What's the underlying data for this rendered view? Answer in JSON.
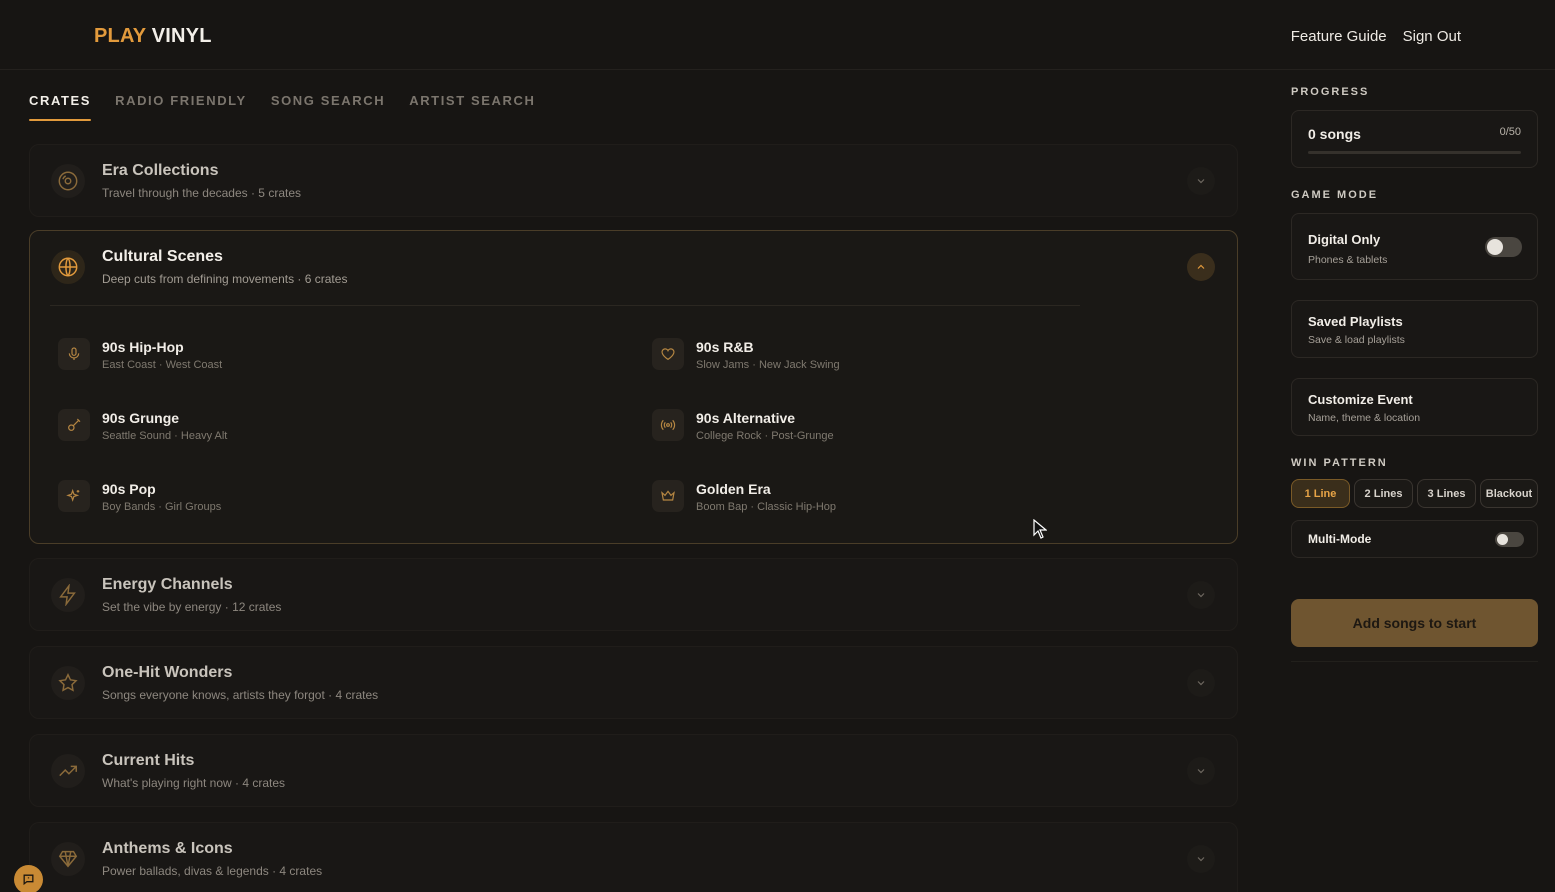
{
  "app": {
    "logo_accent": "PLAY",
    "logo_rest": "VINYL",
    "nav": [
      "Feature Guide",
      "Sign Out"
    ]
  },
  "tabs": [
    {
      "label": "CRATES",
      "active": true
    },
    {
      "label": "RADIO FRIENDLY",
      "active": false
    },
    {
      "label": "SONG SEARCH",
      "active": false
    },
    {
      "label": "ARTIST SEARCH",
      "active": false
    }
  ],
  "categories": [
    {
      "title": "Era Collections",
      "subtitle": "Travel through the decades · 5 crates",
      "icon": "vinyl-icon",
      "open": false
    },
    {
      "title": "Cultural Scenes",
      "subtitle": "Deep cuts from defining movements · 6 crates",
      "icon": "globe-icon",
      "open": true,
      "crates": [
        {
          "title": "90s Hip-Hop",
          "subtitle": "East Coast · West Coast",
          "icon": "microphone-icon"
        },
        {
          "title": "90s R&B",
          "subtitle": "Slow Jams · New Jack Swing",
          "icon": "heart-icon"
        },
        {
          "title": "90s Grunge",
          "subtitle": "Seattle Sound · Heavy Alt",
          "icon": "guitar-icon"
        },
        {
          "title": "90s Alternative",
          "subtitle": "College Rock · Post-Grunge",
          "icon": "radio-waves-icon"
        },
        {
          "title": "90s Pop",
          "subtitle": "Boy Bands · Girl Groups",
          "icon": "sparkles-icon"
        },
        {
          "title": "Golden Era",
          "subtitle": "Boom Bap · Classic Hip-Hop",
          "icon": "crown-icon"
        }
      ]
    },
    {
      "title": "Energy Channels",
      "subtitle": "Set the vibe by energy · 12 crates",
      "icon": "lightning-icon",
      "open": false
    },
    {
      "title": "One-Hit Wonders",
      "subtitle": "Songs everyone knows, artists they forgot · 4 crates",
      "icon": "star-icon",
      "open": false
    },
    {
      "title": "Current Hits",
      "subtitle": "What's playing right now · 4 crates",
      "icon": "trending-up-icon",
      "open": false
    },
    {
      "title": "Anthems & Icons",
      "subtitle": "Power ballads, divas & legends · 4 crates",
      "icon": "diamond-icon",
      "open": false
    }
  ],
  "sidebar": {
    "progress_label": "PROGRESS",
    "progress_songs": "0 songs",
    "progress_count": "0/50",
    "progress_value": 0,
    "game_mode_label": "GAME MODE",
    "digital_title": "Digital Only",
    "digital_sub": "Phones & tablets",
    "digital_on": false,
    "saved_title": "Saved Playlists",
    "saved_sub": "Save & load playlists",
    "customize_title": "Customize Event",
    "customize_sub": "Name, theme & location",
    "win_label": "WIN PATTERN",
    "patterns": [
      "1 Line",
      "2 Lines",
      "3 Lines",
      "Blackout"
    ],
    "pattern_selected": "1 Line",
    "multi_title": "Multi-Mode",
    "multi_on": false,
    "start_label": "Add songs to start"
  },
  "colors": {
    "accent": "#e29a3c",
    "background": "#171513"
  }
}
